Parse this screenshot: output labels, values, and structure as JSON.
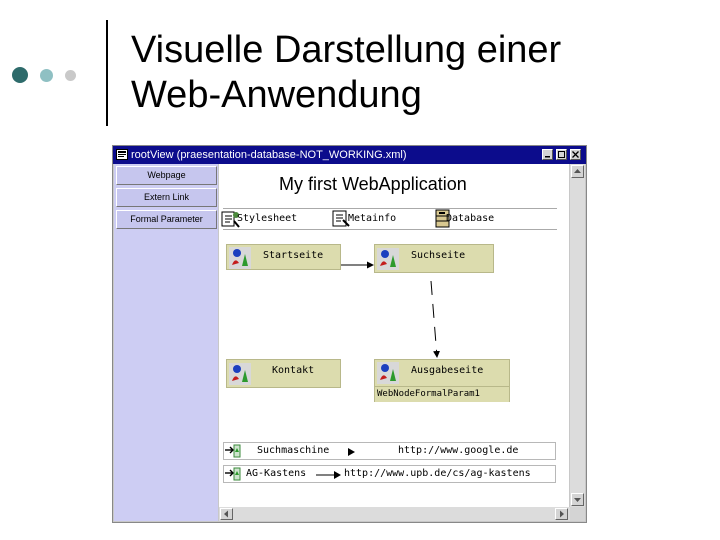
{
  "slide": {
    "title": "Visuelle Darstellung einer Web-Anwendung",
    "bullet_colors": [
      "#2e6b6b",
      "#8fc0c3",
      "#c9c9c9"
    ]
  },
  "window": {
    "title": "rootView (praesentation-database-NOT_WORKING.xml)",
    "controls": [
      "minimize",
      "maximize",
      "close"
    ]
  },
  "left_panel": {
    "buttons": [
      "Webpage",
      "Extern Link",
      "Formal Parameter"
    ]
  },
  "canvas": {
    "app_title": "My first WebApplication",
    "toolbar": [
      {
        "label": "Stylesheet",
        "icon": "stylesheet-icon"
      },
      {
        "label": "Metainfo",
        "icon": "metainfo-icon"
      },
      {
        "label": "Database",
        "icon": "database-icon"
      }
    ],
    "pages": [
      {
        "label": "Startseite"
      },
      {
        "label": "Suchseite"
      },
      {
        "label": "Kontakt"
      },
      {
        "label": "Ausgabeseite",
        "parameter": "WebNodeFormalParam1"
      }
    ],
    "external_links": [
      {
        "name": "Suchmaschine",
        "url": "http://www.google.de"
      },
      {
        "name": "AG-Kastens",
        "url": "http://www.upb.de/cs/ag-kastens"
      }
    ]
  },
  "colors": {
    "titlebar": "#0c0c8c",
    "left_panel": "#cdcdf3",
    "node_fill": "#dcdcae"
  }
}
